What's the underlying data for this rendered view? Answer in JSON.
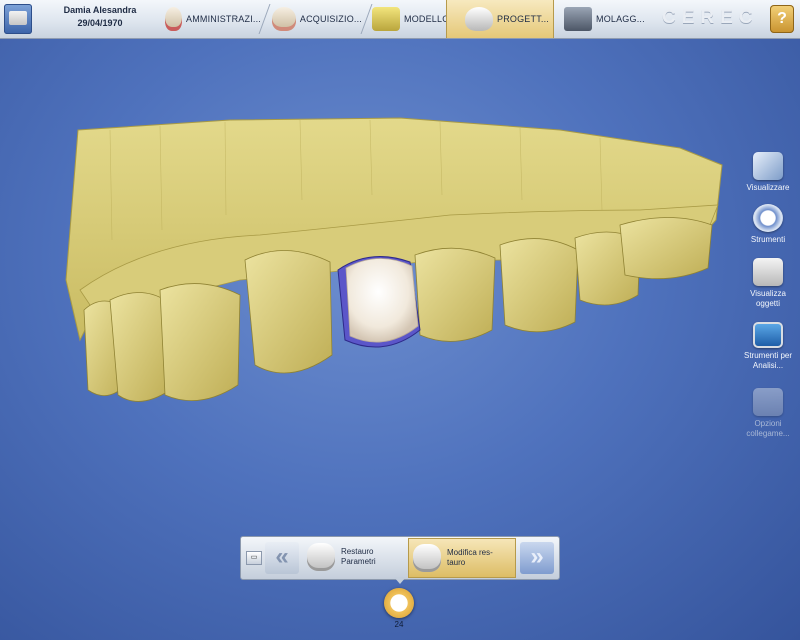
{
  "header": {
    "patient_name": "Damia Alesandra",
    "patient_dob": "29/04/1970",
    "steps": [
      {
        "label": "AMMINISTRAZI..."
      },
      {
        "label": "ACQUISIZIO..."
      },
      {
        "label": "MODELLO"
      },
      {
        "label": "PROGETT..."
      },
      {
        "label": "MOLAGG..."
      }
    ],
    "active_step": "PROGETT...",
    "brand": "CEREC"
  },
  "tools": [
    {
      "label": "Visualizzare",
      "enabled": true
    },
    {
      "label": "Strumenti",
      "enabled": true
    },
    {
      "label": "Visualizza oggetti",
      "enabled": true
    },
    {
      "label": "Strumenti per Analisi...",
      "enabled": true
    },
    {
      "label": "Opzioni collegame...",
      "enabled": false
    }
  ],
  "bottom_nav": {
    "mini_label": "▭",
    "prev_arrow": "«",
    "next_arrow": "»",
    "steps": [
      {
        "label": "Restauro Parametri"
      },
      {
        "label": "Modifica res- tauro"
      }
    ],
    "active_step": "Modifica res- tauro"
  },
  "tooth": {
    "number": "24"
  },
  "colors": {
    "background": "#4f72bd",
    "model": "#d8cc7a",
    "crown": "#f4eee4",
    "crown_margin": "#5b56c9",
    "active_step": "#e5c878"
  }
}
